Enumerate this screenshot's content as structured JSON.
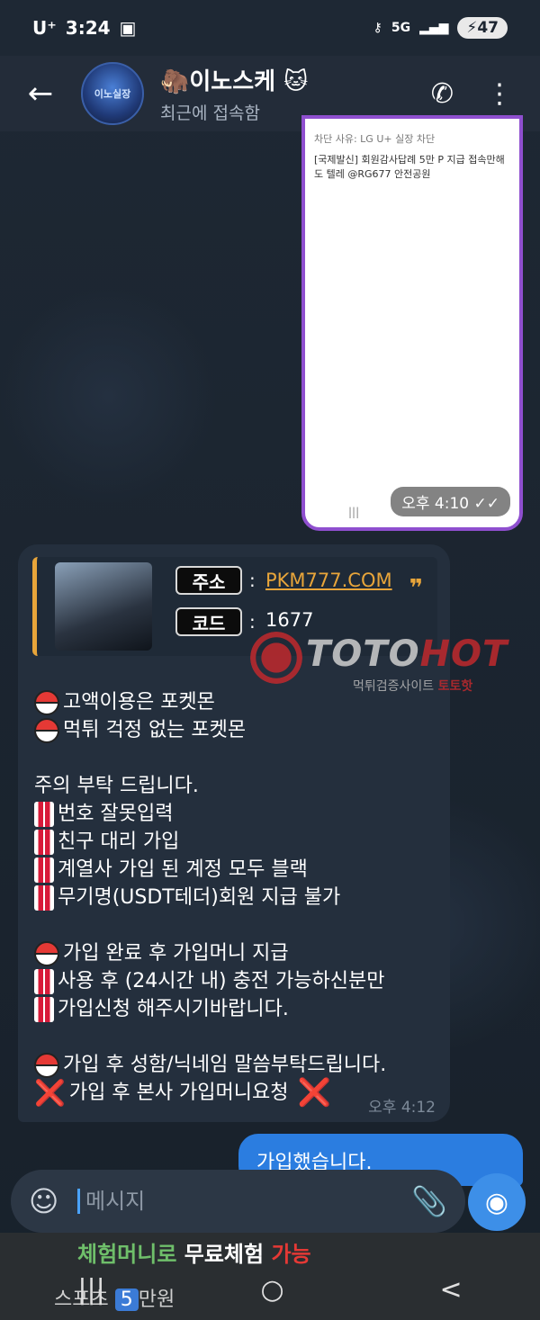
{
  "status_bar": {
    "carrier": "U⁺",
    "time": "3:24",
    "battery": "47"
  },
  "header": {
    "back_icon": "←",
    "title": "🦣이노스케 🐱",
    "subtitle": "최근에 접속함",
    "avatar_label": "이노실장"
  },
  "image_message": {
    "text_line_1": "차단 사유: LG U+ 실장 차단",
    "text_line_2": "[국제발신] 회원감사답례 5만 P 지급 접속만해도 텔레 @RG677 안전공원",
    "nav_hint": "|||",
    "time": "오후 4:10 ✓✓"
  },
  "incoming_message": {
    "promo": {
      "badge_address": "주소",
      "badge_code": "코드",
      "colon": ":",
      "link": "PKM777.COM",
      "code": "1677",
      "quote": "❞"
    },
    "lines": [
      {
        "icon": "pokeball",
        "text": "고액이용은 포켓몬"
      },
      {
        "icon": "pokeball",
        "text": "먹튀 걱정 없는 포켓몬"
      },
      {
        "icon": "gap",
        "text": ""
      },
      {
        "icon": "none",
        "text": "주의 부탁 드립니다."
      },
      {
        "icon": "exclaim",
        "text": "번호 잘못입력"
      },
      {
        "icon": "exclaim",
        "text": "친구 대리 가입"
      },
      {
        "icon": "exclaim",
        "text": "계열사 가입 된 계정 모두 블랙"
      },
      {
        "icon": "exclaim",
        "text": "무기명(USDT테더)회원 지급 불가"
      },
      {
        "icon": "gap",
        "text": ""
      },
      {
        "icon": "pokeball",
        "text": "가입 완료 후 가입머니 지급"
      },
      {
        "icon": "exclaim",
        "text": "사용 후 (24시간 내) 충전 가능하신분만"
      },
      {
        "icon": "exclaim",
        "text": "가입신청 해주시기바랍니다."
      },
      {
        "icon": "gap",
        "text": ""
      },
      {
        "icon": "pokeball",
        "text": "가입 후 성함/닉네임 말씀부탁드립니다."
      },
      {
        "icon": "cross",
        "text": "가입 후 본사 가입머니요청",
        "trail": "❌"
      }
    ],
    "time": "오후 4:12"
  },
  "watermark": {
    "toto": "TOTO",
    "hot": "HOT",
    "sub": "먹튀검증사이트",
    "sub_brand": "토토핫"
  },
  "outgoing_message": {
    "text": "가입했습니다."
  },
  "input": {
    "placeholder": "메시지",
    "sticker_icon": "☺",
    "attach_icon": "📎",
    "camera_icon": "◉"
  },
  "promo_strip": {
    "line_a_1": "체험머니로",
    "line_a_2": "무료체험",
    "line_a_3": "가능",
    "line_b_1": "스포츠",
    "line_b_num": "5",
    "line_b_2": "만원"
  },
  "nav": {
    "recents": "|||",
    "home": "○",
    "back": "<"
  }
}
